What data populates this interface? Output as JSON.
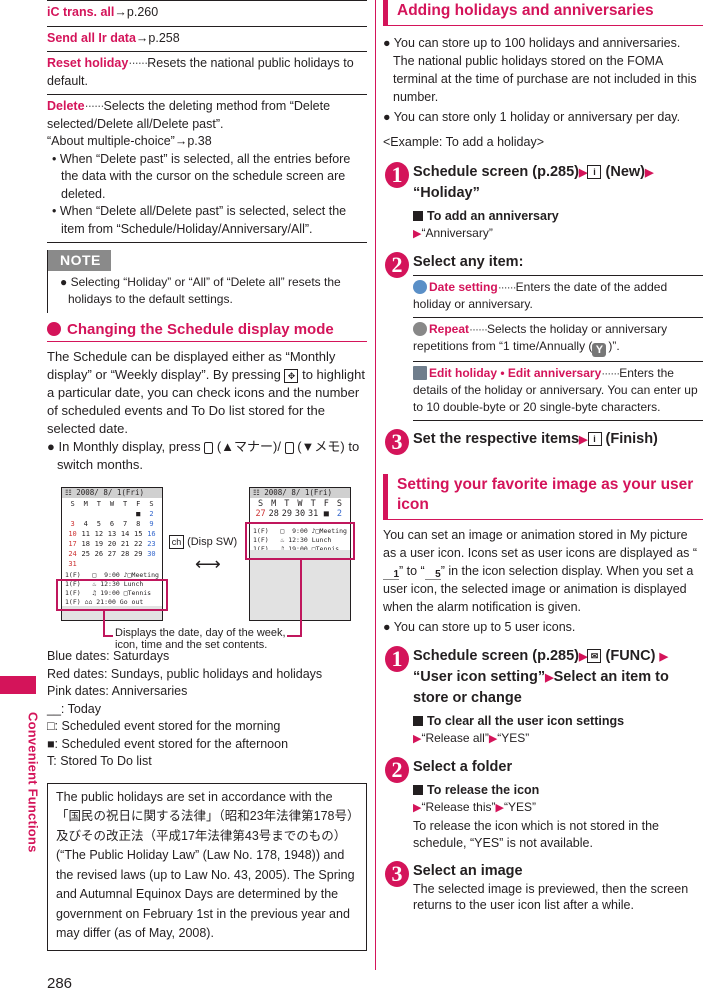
{
  "page": {
    "number": "286",
    "side_label": "Convenient Functions",
    "accent_color": "#d4145a"
  },
  "left": {
    "rows": [
      {
        "term": "iC trans. all",
        "ref": "→p.260"
      },
      {
        "term": "Send all Ir data",
        "ref": "→p.258"
      },
      {
        "term": "Reset holiday",
        "dots": "······",
        "desc": "Resets the national public holidays to default."
      },
      {
        "term": "Delete",
        "dots": "······",
        "desc": "Selects the deleting method from “Delete selected/Delete all/Delete past”.",
        "extra": "“About multiple-choice”→p.38",
        "bullets": [
          "• When “Delete past” is selected, all the entries before the data with the cursor on the schedule screen are deleted.",
          "• When “Delete all/Delete past” is selected, select the item from “Schedule/Holiday/Anniversary/All”."
        ]
      }
    ],
    "note": {
      "label": "NOTE",
      "text": "● Selecting “Holiday” or “All” of “Delete all” resets the holidays to the default settings."
    },
    "section_title": "Changing the Schedule display mode",
    "intro": "The Schedule can be displayed either as “Monthly display” or “Weekly display”. By pressing",
    "intro_key": "✥",
    "intro_rest": "to highlight a particular date, you can check icons and the number of scheduled events and To Do list stored for the selected date.",
    "bullet_pre": "● In Monthly display, press",
    "bullet_mid1": "(▲マナー)/",
    "bullet_mid2": "(▼メモ) to switch months.",
    "figure": {
      "monthly": {
        "title_bar": "☷ 2008/ 8/ 1(Fri)",
        "days": [
          "S",
          "M",
          "T",
          "W",
          "T",
          "F",
          "S",
          "",
          "",
          "",
          "",
          "",
          "■",
          "2",
          "3",
          "4",
          "5",
          "6",
          "7",
          "8",
          "9",
          "10",
          "11",
          "12",
          "13",
          "14",
          "15",
          "16",
          "17",
          "18",
          "19",
          "20",
          "21",
          "22",
          "23",
          "24",
          "25",
          "26",
          "27",
          "28",
          "29",
          "30",
          "31",
          "",
          "",
          "",
          "",
          "",
          ""
        ]
      },
      "weekly": {
        "title_bar": "☷ 2008/ 8/ 1(Fri)",
        "days": [
          "S",
          "M",
          "T",
          "W",
          "T",
          "F",
          "S",
          "27",
          "28",
          "29",
          "30",
          "31",
          "■",
          "2"
        ]
      },
      "events": [
        "1(F)   □  9:00 ♪□Meeting",
        "1(F)   ♨ 12:30 Lunch",
        "1(F)   ♫ 19:00 □Tennis",
        "1(F) ⌂⌂ 21:00 Go out"
      ],
      "switch_key": "ch",
      "switch_label": "(Disp SW)",
      "switch_arrow": "⟷",
      "caption": "Displays the date, day of the week, icon, time and the set contents."
    },
    "legend": [
      "Blue dates: Saturdays",
      "Red dates: Sundays, public holidays and holidays",
      "Pink dates: Anniversaries",
      "__: Today",
      "□: Scheduled event stored for the morning",
      "■: Scheduled event stored for the afternoon",
      "T: Stored To Do list"
    ],
    "box_text": "The public holidays are set in accordance with the 「国民の祝日に関する法律」（昭和23年法律第178号）及びその改正法（平成17年法律第43号までのもの）(“The Public Holiday Law” (Law No. 178, 1948)) and the revised laws (up to Law No. 43, 2005). The Spring and Autumnal Equinox Days are determined by the government on February 1st in the previous year and may differ (as of May, 2008)."
  },
  "right": {
    "section1": {
      "title": "Adding holidays and anniversaries",
      "bullets": [
        "● You can store up to 100 holidays and anniversaries. The national public holidays stored on the FOMA terminal at the time of purchase are not included in this number.",
        "● You can store only 1 holiday or anniversary per day."
      ],
      "example": "<Example: To add a holiday>",
      "steps": [
        {
          "num": "1",
          "parts": [
            "Schedule screen (p.285)",
            "i",
            "(New)",
            "“Holiday”"
          ],
          "sub_title": "To add an anniversary",
          "sub_text": "“Anniversary”"
        },
        {
          "num": "2",
          "text": "Select any item:",
          "items": [
            {
              "icon": "clock",
              "term": "Date setting",
              "dots": "······",
              "desc": "Enters the date of the added holiday or anniversary."
            },
            {
              "icon": "repeat",
              "term": "Repeat",
              "dots": "······",
              "desc": "Selects the holiday or anniversary repetitions from “1 time/Annually (",
              "badge": "Y",
              "desc_end": ")”."
            },
            {
              "icon": "list",
              "term": "Edit holiday • Edit anniversary",
              "dots": "······",
              "desc": "Enters the details of the holiday or anniversary. You can enter up to 10 double-byte or 20 single-byte characters."
            }
          ]
        },
        {
          "num": "3",
          "parts": [
            "Set the respective items",
            "i",
            "(Finish)"
          ]
        }
      ]
    },
    "section2": {
      "title": "Setting your favorite image as your user icon",
      "intro_a": "You can set an image or animation stored in My picture as a user icon. Icons set as user icons are displayed as “",
      "icon1": "1",
      "intro_b": "” to “",
      "icon5": "5",
      "intro_c": "” in the icon selection display. When you set a user icon, the selected image or animation is displayed when the alarm notification is given.",
      "bullet": "● You can store up to 5 user icons.",
      "steps": [
        {
          "num": "1",
          "a": "Schedule screen (p.285)",
          "key": "✉",
          "b": "(FUNC)",
          "c": "“User icon setting”",
          "d": "Select an item to store or change",
          "sub_title": "To clear all the user icon settings",
          "sub_a": "“Release all”",
          "sub_b": "“YES”"
        },
        {
          "num": "2",
          "text": "Select a folder",
          "sub_title": "To release the icon",
          "sub_a": "“Release this”",
          "sub_b": "“YES”",
          "note": "To release the icon which is not stored in the schedule, “YES” is not available."
        },
        {
          "num": "3",
          "text": "Select an image",
          "desc": "The selected image is previewed, then the screen returns to the user icon list after a while."
        }
      ]
    }
  }
}
